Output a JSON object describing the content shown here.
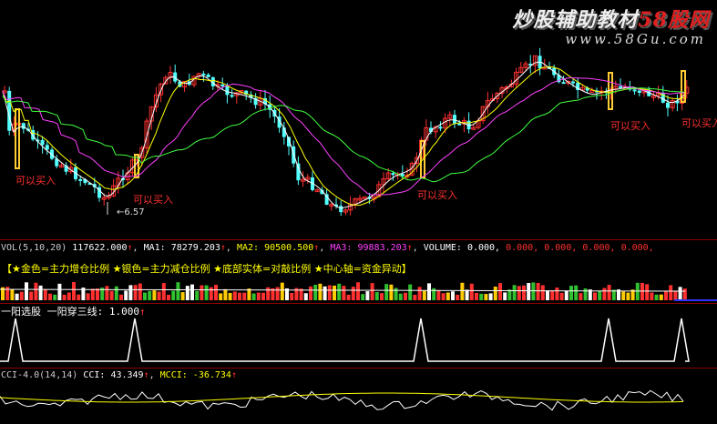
{
  "watermark": {
    "brand": "炒股辅助教材",
    "brand_num": "58股网",
    "url": "www.58Gu.com"
  },
  "price_panel": {
    "low_marker": "6.57",
    "buy_label": "可以买入",
    "colors": {
      "up": "#ff3030",
      "down": "#54ffff",
      "ma1": "#ffffff",
      "ma2": "#ffff00",
      "ma3": "#ff40ff",
      "ma4": "#40ff40",
      "highlight": "#ffcc33"
    }
  },
  "vol_panel": {
    "title": "VOL(5,10,20)",
    "value": "117622.000",
    "ma1_label": "MA1:",
    "ma1_value": "78279.203",
    "ma2_label": "MA2:",
    "ma2_value": "90500.500",
    "ma3_label": "MA3:",
    "ma3_value": "99883.203",
    "volume_label": "VOLUME:",
    "volume_value": "0.000,",
    "extra_values": [
      "0.000,",
      "0.000,",
      "0.000,",
      "0.000,"
    ],
    "legend": "【★金色=主力增仓比例  ★银色=主力减仓比例  ★底部实体=对敲比例  ★中心轴=资金异动】",
    "arrow": "↑"
  },
  "signal_panel": {
    "title": "一阳选股",
    "series": "一阳穿三线:",
    "value": "1.000",
    "arrow": "↑"
  },
  "cci_panel": {
    "title": "CCI-4.0(14,14)",
    "cci_label": "CCI:",
    "cci_value": "43.349",
    "mcci_label": "MCCI:",
    "mcci_value": "-36.734",
    "arrow": "↑"
  }
}
